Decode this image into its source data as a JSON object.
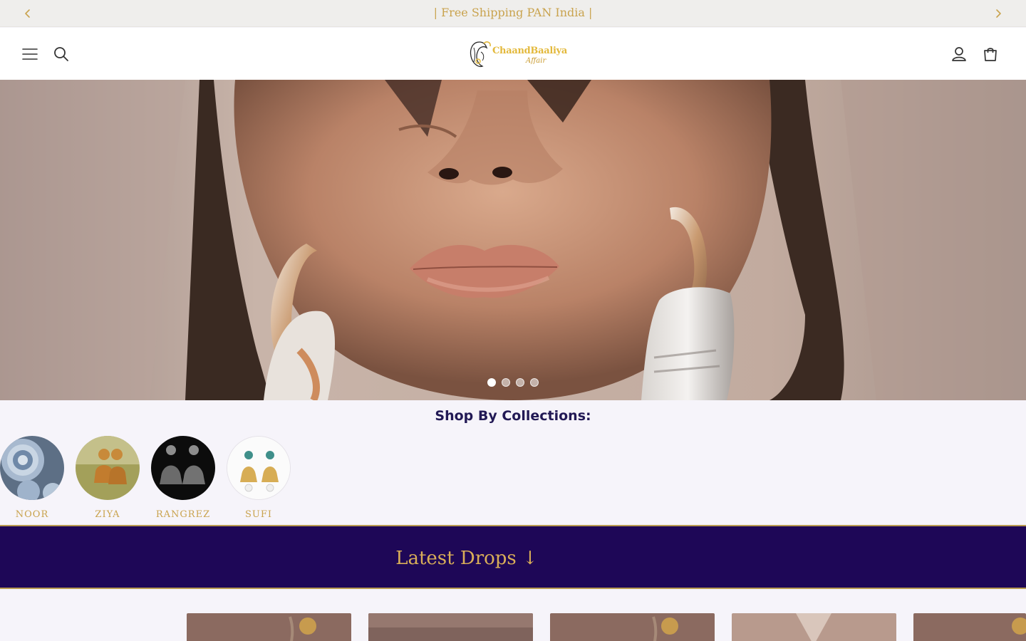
{
  "announcement": {
    "text": "| Free Shipping PAN India |",
    "prev_icon": "chevron-left-icon",
    "next_icon": "chevron-right-icon"
  },
  "header": {
    "menu_icon": "hamburger-icon",
    "search_icon": "search-icon",
    "logo": {
      "name": "ChaandBaaliya",
      "sub": "Affair"
    },
    "account_icon": "user-icon",
    "cart_icon": "bag-icon"
  },
  "hero": {
    "slide_count": 4,
    "active_slide": 1
  },
  "collections": {
    "title": "Shop By Collections:",
    "items": [
      {
        "label": "NOOR"
      },
      {
        "label": "ZIYA"
      },
      {
        "label": "RANGREZ"
      },
      {
        "label": "SUFI"
      }
    ]
  },
  "latest_drops": {
    "title": "Latest Drops ↓"
  },
  "products": {
    "visible_count": 5
  },
  "colors": {
    "gold": "#c9a34e",
    "navy": "#1e0757",
    "title_dark": "#221955",
    "page_bg": "#f6f4fa"
  }
}
